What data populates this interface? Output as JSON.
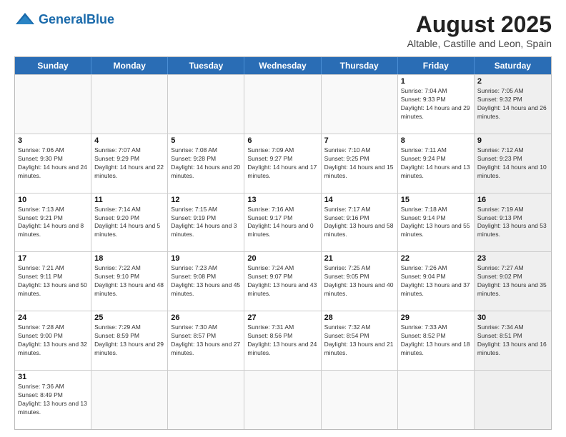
{
  "header": {
    "logo_general": "General",
    "logo_blue": "Blue",
    "title": "August 2025",
    "subtitle": "Altable, Castille and Leon, Spain"
  },
  "days_of_week": [
    "Sunday",
    "Monday",
    "Tuesday",
    "Wednesday",
    "Thursday",
    "Friday",
    "Saturday"
  ],
  "rows": [
    [
      {
        "day": "",
        "empty": true
      },
      {
        "day": "",
        "empty": true
      },
      {
        "day": "",
        "empty": true
      },
      {
        "day": "",
        "empty": true
      },
      {
        "day": "",
        "empty": true
      },
      {
        "day": "1",
        "info": "Sunrise: 7:04 AM\nSunset: 9:33 PM\nDaylight: 14 hours and 29 minutes."
      },
      {
        "day": "2",
        "info": "Sunrise: 7:05 AM\nSunset: 9:32 PM\nDaylight: 14 hours and 26 minutes.",
        "shaded": true
      }
    ],
    [
      {
        "day": "3",
        "info": "Sunrise: 7:06 AM\nSunset: 9:30 PM\nDaylight: 14 hours and 24 minutes."
      },
      {
        "day": "4",
        "info": "Sunrise: 7:07 AM\nSunset: 9:29 PM\nDaylight: 14 hours and 22 minutes."
      },
      {
        "day": "5",
        "info": "Sunrise: 7:08 AM\nSunset: 9:28 PM\nDaylight: 14 hours and 20 minutes."
      },
      {
        "day": "6",
        "info": "Sunrise: 7:09 AM\nSunset: 9:27 PM\nDaylight: 14 hours and 17 minutes."
      },
      {
        "day": "7",
        "info": "Sunrise: 7:10 AM\nSunset: 9:25 PM\nDaylight: 14 hours and 15 minutes."
      },
      {
        "day": "8",
        "info": "Sunrise: 7:11 AM\nSunset: 9:24 PM\nDaylight: 14 hours and 13 minutes."
      },
      {
        "day": "9",
        "info": "Sunrise: 7:12 AM\nSunset: 9:23 PM\nDaylight: 14 hours and 10 minutes.",
        "shaded": true
      }
    ],
    [
      {
        "day": "10",
        "info": "Sunrise: 7:13 AM\nSunset: 9:21 PM\nDaylight: 14 hours and 8 minutes."
      },
      {
        "day": "11",
        "info": "Sunrise: 7:14 AM\nSunset: 9:20 PM\nDaylight: 14 hours and 5 minutes."
      },
      {
        "day": "12",
        "info": "Sunrise: 7:15 AM\nSunset: 9:19 PM\nDaylight: 14 hours and 3 minutes."
      },
      {
        "day": "13",
        "info": "Sunrise: 7:16 AM\nSunset: 9:17 PM\nDaylight: 14 hours and 0 minutes."
      },
      {
        "day": "14",
        "info": "Sunrise: 7:17 AM\nSunset: 9:16 PM\nDaylight: 13 hours and 58 minutes."
      },
      {
        "day": "15",
        "info": "Sunrise: 7:18 AM\nSunset: 9:14 PM\nDaylight: 13 hours and 55 minutes."
      },
      {
        "day": "16",
        "info": "Sunrise: 7:19 AM\nSunset: 9:13 PM\nDaylight: 13 hours and 53 minutes.",
        "shaded": true
      }
    ],
    [
      {
        "day": "17",
        "info": "Sunrise: 7:21 AM\nSunset: 9:11 PM\nDaylight: 13 hours and 50 minutes."
      },
      {
        "day": "18",
        "info": "Sunrise: 7:22 AM\nSunset: 9:10 PM\nDaylight: 13 hours and 48 minutes."
      },
      {
        "day": "19",
        "info": "Sunrise: 7:23 AM\nSunset: 9:08 PM\nDaylight: 13 hours and 45 minutes."
      },
      {
        "day": "20",
        "info": "Sunrise: 7:24 AM\nSunset: 9:07 PM\nDaylight: 13 hours and 43 minutes."
      },
      {
        "day": "21",
        "info": "Sunrise: 7:25 AM\nSunset: 9:05 PM\nDaylight: 13 hours and 40 minutes."
      },
      {
        "day": "22",
        "info": "Sunrise: 7:26 AM\nSunset: 9:04 PM\nDaylight: 13 hours and 37 minutes."
      },
      {
        "day": "23",
        "info": "Sunrise: 7:27 AM\nSunset: 9:02 PM\nDaylight: 13 hours and 35 minutes.",
        "shaded": true
      }
    ],
    [
      {
        "day": "24",
        "info": "Sunrise: 7:28 AM\nSunset: 9:00 PM\nDaylight: 13 hours and 32 minutes."
      },
      {
        "day": "25",
        "info": "Sunrise: 7:29 AM\nSunset: 8:59 PM\nDaylight: 13 hours and 29 minutes."
      },
      {
        "day": "26",
        "info": "Sunrise: 7:30 AM\nSunset: 8:57 PM\nDaylight: 13 hours and 27 minutes."
      },
      {
        "day": "27",
        "info": "Sunrise: 7:31 AM\nSunset: 8:56 PM\nDaylight: 13 hours and 24 minutes."
      },
      {
        "day": "28",
        "info": "Sunrise: 7:32 AM\nSunset: 8:54 PM\nDaylight: 13 hours and 21 minutes."
      },
      {
        "day": "29",
        "info": "Sunrise: 7:33 AM\nSunset: 8:52 PM\nDaylight: 13 hours and 18 minutes."
      },
      {
        "day": "30",
        "info": "Sunrise: 7:34 AM\nSunset: 8:51 PM\nDaylight: 13 hours and 16 minutes.",
        "shaded": true
      }
    ],
    [
      {
        "day": "31",
        "info": "Sunrise: 7:36 AM\nSunset: 8:49 PM\nDaylight: 13 hours and 13 minutes."
      },
      {
        "day": "",
        "empty": true
      },
      {
        "day": "",
        "empty": true
      },
      {
        "day": "",
        "empty": true
      },
      {
        "day": "",
        "empty": true
      },
      {
        "day": "",
        "empty": true
      },
      {
        "day": "",
        "empty": true,
        "shaded": true
      }
    ]
  ]
}
